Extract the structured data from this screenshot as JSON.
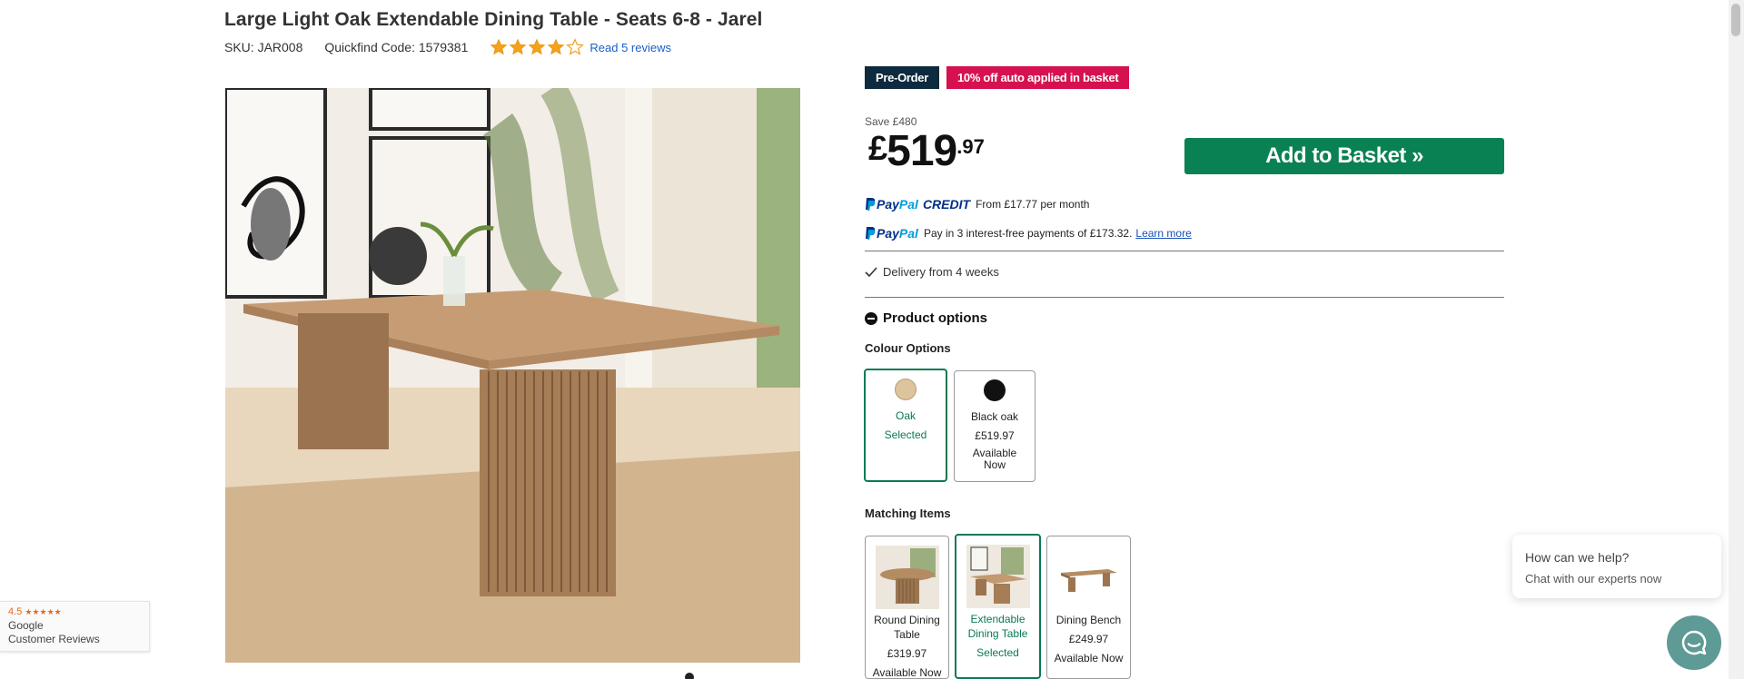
{
  "product": {
    "title": "Large Light Oak Extendable Dining Table - Seats 6-8 - Jarel",
    "sku": "SKU: JAR008",
    "quickfind": "Quickfind Code: 1579381",
    "rating_stars": 4,
    "reviews_link": "Read 5 reviews"
  },
  "badges": {
    "preorder": "Pre-Order",
    "discount": "10% off auto applied in basket"
  },
  "pricing": {
    "save": "Save £480",
    "currency": "£",
    "pounds": "519",
    "pence": ".97"
  },
  "buttons": {
    "add_to_basket": "Add to Basket »"
  },
  "paypal": {
    "logo_p1": "Pay",
    "logo_p2": "Pal",
    "credit_word": "CREDIT",
    "credit_text": "From £17.77 per month",
    "pay3_text": "Pay in 3 interest-free payments of £173.32.",
    "learn_more": "Learn more"
  },
  "delivery": {
    "text": "Delivery from 4 weeks"
  },
  "options": {
    "heading": "Product options",
    "colour_label": "Colour Options",
    "colours": [
      {
        "name": "Oak",
        "status": "Selected",
        "swatch": "#dcc49d"
      },
      {
        "name": "Black oak",
        "price": "£519.97",
        "availability": "Available Now",
        "swatch": "#111111"
      }
    ],
    "matching_label": "Matching Items",
    "matching": [
      {
        "name": "Round Dining Table",
        "price": "£319.97",
        "availability": "Available Now"
      },
      {
        "name": "Extendable Dining Table",
        "status": "Selected"
      },
      {
        "name": "Dining Bench",
        "price": "£249.97",
        "availability": "Available Now"
      }
    ]
  },
  "google": {
    "rating": "4.5",
    "stars": "★★★★★",
    "line1": "Google",
    "line2": "Customer Reviews"
  },
  "chat": {
    "title": "How can we help?",
    "subtitle": "Chat with our experts now"
  },
  "colors": {
    "brand_green": "#0a8152",
    "selected_border": "#0a7a52",
    "preorder_bg": "#0d2a3e",
    "discount_bg": "#d6114f",
    "star": "#f5a21b"
  }
}
